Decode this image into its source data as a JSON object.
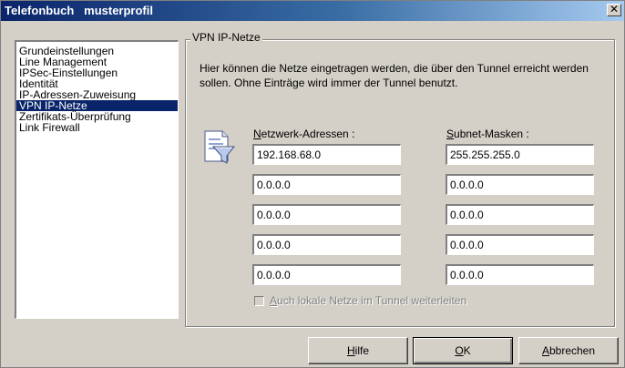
{
  "window": {
    "title": "Telefonbuch   musterprofil",
    "close_symbol": "✕"
  },
  "nav": {
    "items": [
      {
        "label": "Grundeinstellungen",
        "selected": false
      },
      {
        "label": "Line Management",
        "selected": false
      },
      {
        "label": "IPSec-Einstellungen",
        "selected": false
      },
      {
        "label": "Identität",
        "selected": false
      },
      {
        "label": "IP-Adressen-Zuweisung",
        "selected": false
      },
      {
        "label": "VPN IP-Netze",
        "selected": true
      },
      {
        "label": "Zertifikats-Überprüfung",
        "selected": false
      },
      {
        "label": "Link Firewall",
        "selected": false
      }
    ]
  },
  "panel": {
    "legend": "VPN IP-Netze",
    "description": "Hier können die Netze eingetragen werden, die über den Tunnel erreicht werden sollen. Ohne Einträge wird immer der Tunnel benutzt.",
    "network_header_mnemonic": "N",
    "network_header_rest": "etzwerk-Adressen :",
    "subnet_header_mnemonic": "S",
    "subnet_header_rest": "ubnet-Masken :",
    "rows": [
      {
        "address": "192.168.68.0",
        "mask": "255.255.255.0"
      },
      {
        "address": "0.0.0.0",
        "mask": "0.0.0.0"
      },
      {
        "address": "0.0.0.0",
        "mask": "0.0.0.0"
      },
      {
        "address": "0.0.0.0",
        "mask": "0.0.0.0"
      },
      {
        "address": "0.0.0.0",
        "mask": "0.0.0.0"
      }
    ],
    "checkbox_mnemonic": "A",
    "checkbox_rest": "uch lokale Netze im Tunnel weiterleiten",
    "checkbox_checked": false,
    "checkbox_disabled": true
  },
  "buttons": {
    "help_mnemonic": "H",
    "help_rest": "ilfe",
    "ok_mnemonic": "O",
    "ok_rest": "K",
    "cancel_mnemonic": "A",
    "cancel_rest": "bbrechen"
  },
  "colors": {
    "title_active": "#0a246a",
    "selection": "#0a246a",
    "face": "#d4d0c8"
  },
  "icons": {
    "network_icon": "network-filter-icon"
  }
}
